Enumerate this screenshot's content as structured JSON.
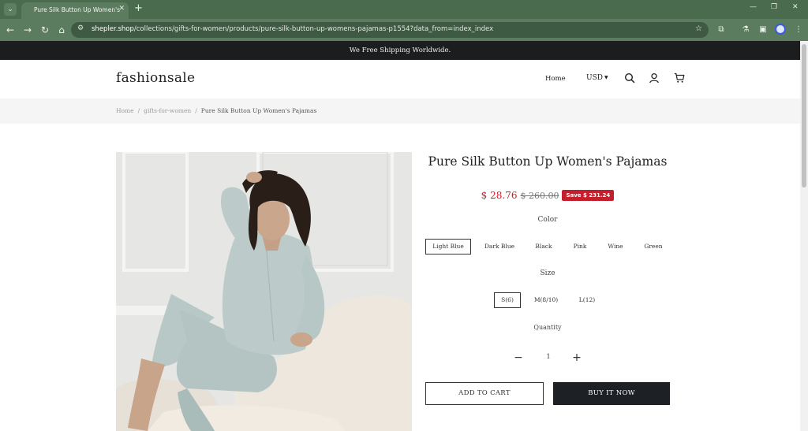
{
  "browser": {
    "tab_title": "Pure Silk Button Up Women's P",
    "tab_close": "✕",
    "new_tab": "+",
    "url_host": "shepler.shop",
    "url_path": "/collections/gifts-for-women/products/pure-silk-button-up-womens-pajamas-p1554?data_from=index_index"
  },
  "announcement": "We Free Shipping Worldwide.",
  "header": {
    "logo": "fashionsale",
    "nav_home": "Home",
    "currency": "USD"
  },
  "breadcrumb": {
    "home": "Home",
    "sep": "/",
    "collection": "gifts-for-women",
    "current": "Pure Silk Button Up Women's Pajamas"
  },
  "product": {
    "title": "Pure Silk Button Up Women's Pajamas",
    "price": "$ 28.76",
    "compare_price": "$ 260.00",
    "save_badge": "Save $ 231.24",
    "color_label": "Color",
    "colors": [
      "Light Blue",
      "Dark Blue",
      "Black",
      "Pink",
      "Wine",
      "Green"
    ],
    "selected_color": "Light Blue",
    "size_label": "Size",
    "sizes": [
      "S(6)",
      "M(8/10)",
      "L(12)"
    ],
    "selected_size": "S(6)",
    "quantity_label": "Quantity",
    "quantity": "1",
    "add_to_cart": "ADD TO CART",
    "buy_now": "BUY IT NOW"
  },
  "colors": {
    "chrome_dark": "#4b6b4f",
    "chrome": "#5c7c5f",
    "announce_bg": "#1b1d1f",
    "sale_red": "#d0202a",
    "badge_red": "#c41f2d",
    "buy_btn": "#1d2024"
  }
}
